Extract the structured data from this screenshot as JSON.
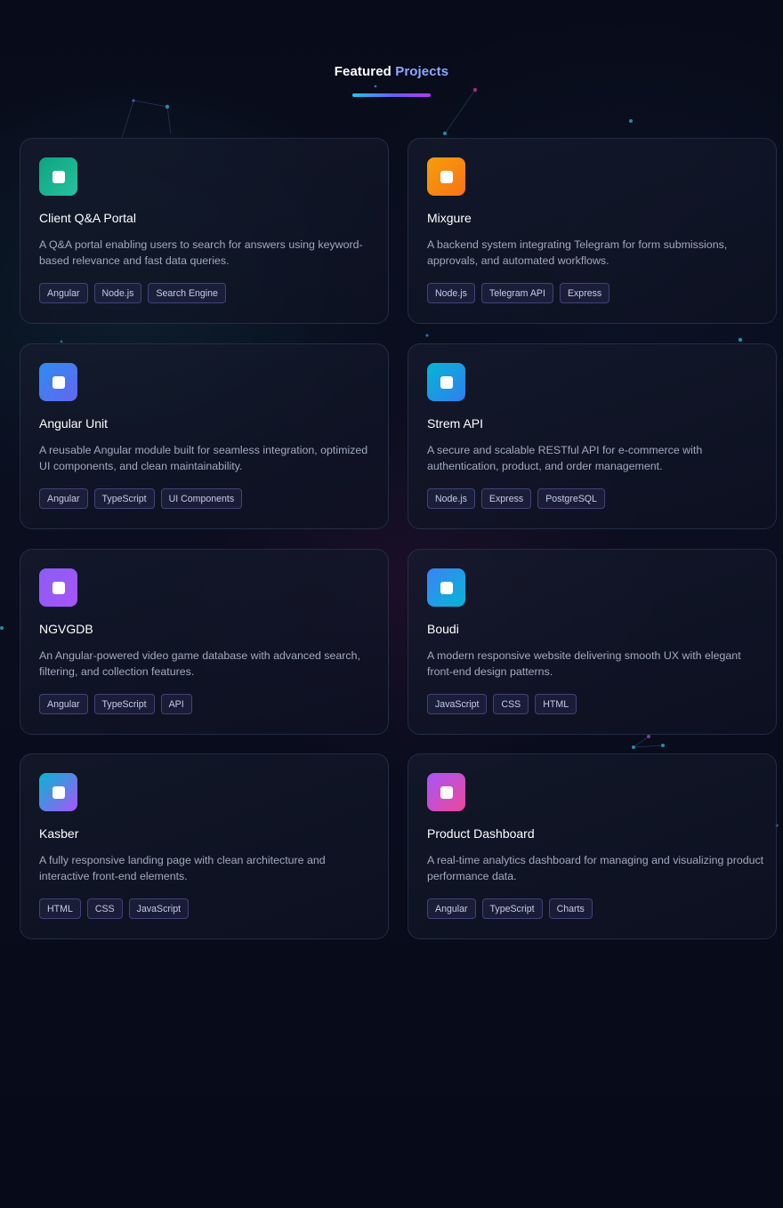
{
  "header": {
    "title_main": "Featured",
    "title_accent": "Projects"
  },
  "projects": [
    {
      "title": "Client Q&A Portal",
      "description": "A Q&A portal enabling users to search for answers using keyword-based relevance and fast data queries.",
      "tags": [
        "Angular",
        "Node.js",
        "Search Engine"
      ],
      "icon": "project-icon",
      "gradient": [
        "#0fa37f",
        "#25c2a0"
      ]
    },
    {
      "title": "Mixgure",
      "description": "A backend system integrating Telegram for form submissions, approvals, and automated workflows.",
      "tags": [
        "Node.js",
        "Telegram API",
        "Express"
      ],
      "icon": "project-icon",
      "gradient": [
        "#f59e0b",
        "#f97316"
      ]
    },
    {
      "title": "Angular Unit",
      "description": "A reusable Angular module built for seamless integration, optimized UI components, and clean maintainability.",
      "tags": [
        "Angular",
        "TypeScript",
        "UI Components"
      ],
      "icon": "project-icon",
      "gradient": [
        "#2f8cf0",
        "#6366f1"
      ]
    },
    {
      "title": "Strem API",
      "description": "A secure and scalable RESTful API for e-commerce with authentication, product, and order management.",
      "tags": [
        "Node.js",
        "Express",
        "PostgreSQL"
      ],
      "icon": "project-icon",
      "gradient": [
        "#06b6d4",
        "#2f7ef0"
      ]
    },
    {
      "title": "NGVGDB",
      "description": "An Angular-powered video game database with advanced search, filtering, and collection features.",
      "tags": [
        "Angular",
        "TypeScript",
        "API"
      ],
      "icon": "project-icon",
      "gradient": [
        "#8b5cf6",
        "#a855f7"
      ]
    },
    {
      "title": "Boudi",
      "description": "A modern responsive website delivering smooth UX with elegant front-end design patterns.",
      "tags": [
        "JavaScript",
        "CSS",
        "HTML"
      ],
      "icon": "project-icon",
      "gradient": [
        "#3b82f6",
        "#06b6d4"
      ]
    },
    {
      "title": "Kasber",
      "description": "A fully responsive landing page with clean architecture and interactive front-end elements.",
      "tags": [
        "HTML",
        "CSS",
        "JavaScript"
      ],
      "icon": "project-icon",
      "gradient": [
        "#06b6d4",
        "#a855f7"
      ]
    },
    {
      "title": "Product Dashboard",
      "description": "A real-time analytics dashboard for managing and visualizing product performance data.",
      "tags": [
        "Angular",
        "TypeScript",
        "Charts"
      ],
      "icon": "project-icon",
      "gradient": [
        "#a855f7",
        "#ec4899"
      ]
    }
  ]
}
